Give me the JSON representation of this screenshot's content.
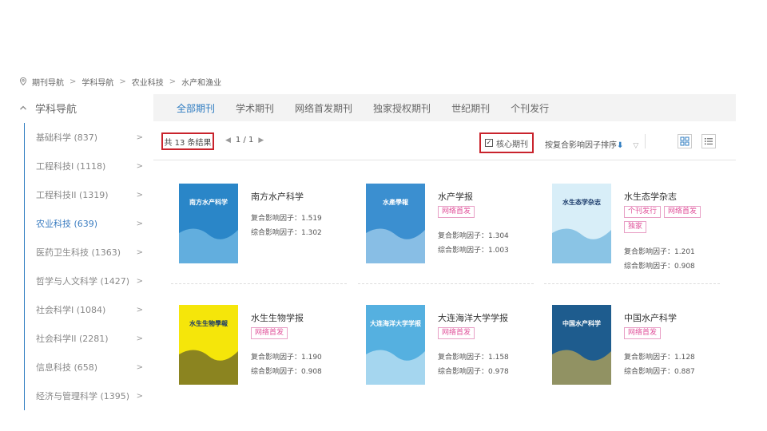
{
  "breadcrumb": {
    "items": [
      "期刊导航",
      "学科导航",
      "农业科技",
      "水产和渔业"
    ],
    "separator": ">"
  },
  "sidebar": {
    "title": "学科导航",
    "items": [
      {
        "label": "基础科学 (837)"
      },
      {
        "label": "工程科技I (1118)"
      },
      {
        "label": "工程科技II (1319)"
      },
      {
        "label": "农业科技 (639)"
      },
      {
        "label": "医药卫生科技 (1363)"
      },
      {
        "label": "哲学与人文科学 (1427)"
      },
      {
        "label": "社会科学I (1084)"
      },
      {
        "label": "社会科学II (2281)"
      },
      {
        "label": "信息科技 (658)"
      },
      {
        "label": "经济与管理科学 (1395)"
      }
    ],
    "arrow": ">"
  },
  "tabs": [
    "全部期刊",
    "学术期刊",
    "网络首发期刊",
    "独家授权期刊",
    "世纪期刊",
    "个刊发行"
  ],
  "toolbar": {
    "total": "共 13 条结果",
    "page": "1 / 1",
    "core_label": "核心期刊",
    "sort_label": "按复合影响因子排序",
    "sort_arrow": "⬇"
  },
  "journals": [
    {
      "title": "南方水产科学",
      "tags": [],
      "metrics": [
        "复合影响因子：1.519",
        "综合影响因子：1.302"
      ],
      "cover": {
        "bg": "#2a86c8",
        "accent": "#8fd0f0",
        "text": "南方水产科学"
      }
    },
    {
      "title": "水产学报",
      "tags": [
        "网络首发"
      ],
      "metrics": [
        "复合影响因子：1.304",
        "综合影响因子：1.003"
      ],
      "cover": {
        "bg": "#3b8fd0",
        "accent": "#c9e6f5",
        "text": "水產學報"
      }
    },
    {
      "title": "水生态学杂志",
      "tags": [
        "个刊发行",
        "网络首发",
        "独家"
      ],
      "metrics": [
        "复合影响因子：1.201",
        "综合影响因子：0.908"
      ],
      "cover": {
        "bg": "#d8eef8",
        "accent": "#4aa2d6",
        "text": "水生态学杂志"
      }
    },
    {
      "title": "水生生物学报",
      "tags": [
        "网络首发"
      ],
      "metrics": [
        "复合影响因子：1.190",
        "综合影响因子：0.908"
      ],
      "cover": {
        "bg": "#f5e60a",
        "accent": "#333333",
        "text": "水生生物學報"
      }
    },
    {
      "title": "大连海洋大学学报",
      "tags": [
        "网络首发"
      ],
      "metrics": [
        "复合影响因子：1.158",
        "综合影响因子：0.978"
      ],
      "cover": {
        "bg": "#55b0e0",
        "accent": "#e8f5fc",
        "text": "大连海洋大学学报"
      }
    },
    {
      "title": "中国水产科学",
      "tags": [
        "网络首发"
      ],
      "metrics": [
        "复合影响因子：1.128",
        "综合影响因子：0.887"
      ],
      "cover": {
        "bg": "#1e5c8e",
        "accent": "#f0c040",
        "text": "中国水产科学"
      }
    }
  ]
}
